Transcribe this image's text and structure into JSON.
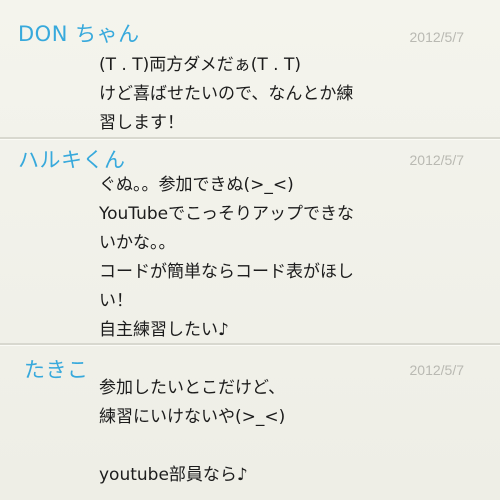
{
  "messages": [
    {
      "sender": "DON ちゃん",
      "date": "2012/5/7",
      "lines": [
        "(T . T)両方ダメだぁ(T . T)",
        "けど喜ばせたいので、なんとか練",
        "習します！"
      ]
    },
    {
      "sender": "ハルキくん",
      "date": "2012/5/7",
      "lines": [
        "ぐぬ。。参加できぬ(>_<)",
        "YouTubeでこっそりアップできな",
        "いかな。。",
        "コードが簡単ならコード表がほし",
        "い！",
        "自主練習したい♪"
      ]
    },
    {
      "sender": "たきこ",
      "date": "2012/5/7",
      "lines": [
        "参加したいとこだけど、",
        "練習にいけないや(>_<)",
        "",
        "youtube部員なら♪"
      ]
    }
  ],
  "colors": {
    "sender": "#37a9dc",
    "date": "#b9b9b2",
    "text": "#1c1c1c",
    "background": "#f1f1e9"
  }
}
